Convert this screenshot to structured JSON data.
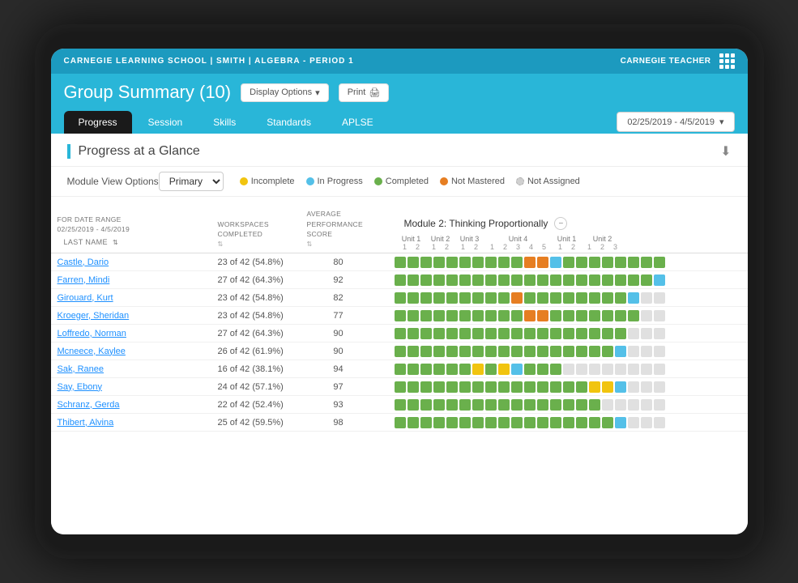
{
  "topBar": {
    "title": "CARNEGIE LEARNING SCHOOL | SMITH | ALGEBRA - PERIOD 1",
    "user": "Carnegie Teacher"
  },
  "header": {
    "title": "Group Summary (10)",
    "displayOptionsLabel": "Display Options",
    "printLabel": "Print"
  },
  "tabs": [
    {
      "id": "progress",
      "label": "Progress",
      "active": true
    },
    {
      "id": "session",
      "label": "Session",
      "active": false
    },
    {
      "id": "skills",
      "label": "Skills",
      "active": false
    },
    {
      "id": "standards",
      "label": "Standards",
      "active": false
    },
    {
      "id": "aplse",
      "label": "APLSE",
      "active": false
    }
  ],
  "dateRange": "02/25/2019 - 4/5/2019",
  "sectionTitle": "Progress at a Glance",
  "moduleViewOptions": {
    "label": "Module View Options",
    "value": "Primary"
  },
  "legend": [
    {
      "label": "Incomplete",
      "color": "#f1c40f"
    },
    {
      "label": "In Progress",
      "color": "#54c0e8"
    },
    {
      "label": "Completed",
      "color": "#6ab04c"
    },
    {
      "label": "Not Mastered",
      "color": "#e67e22"
    },
    {
      "label": "Not Assigned",
      "color": "#d0d0d0"
    }
  ],
  "tableHeaders": {
    "lastName": "LAST NAME",
    "dateRange": "FOR DATE RANGE\n02/25/2019 - 4/5/2019",
    "workspacesCompleted": "WORKSPACES COMPLETED",
    "avgPerformanceScore": "AVERAGE PERFORMANCE SCORE"
  },
  "moduleTitle": "Module 2: Thinking Proportionally",
  "units": [
    {
      "label": "Unit 1",
      "cells": [
        1,
        2
      ]
    },
    {
      "label": "Unit 2",
      "cells": [
        1,
        2
      ]
    },
    {
      "label": "Unit 3",
      "cells": [
        1,
        2
      ]
    },
    {
      "label": "Unit 4",
      "cells": [
        1,
        2,
        3,
        4,
        5
      ]
    },
    {
      "label": "Unit 1",
      "cells": [
        1,
        2
      ]
    },
    {
      "label": "Unit 2",
      "cells": [
        1,
        2,
        3
      ]
    }
  ],
  "students": [
    {
      "name": "Castle, Dario",
      "workspaces": "23 of 42 (54.8%)",
      "score": "80",
      "cells": [
        "g",
        "g",
        "g",
        "g",
        "g",
        "g",
        "g",
        "g",
        "g",
        "g",
        "o",
        "o",
        "b",
        "g",
        "g",
        "g",
        "g",
        "g",
        "g",
        "g",
        "g"
      ]
    },
    {
      "name": "Farren, Mindi",
      "workspaces": "27 of 42 (64.3%)",
      "score": "92",
      "cells": [
        "g",
        "g",
        "g",
        "g",
        "g",
        "g",
        "g",
        "g",
        "g",
        "g",
        "g",
        "g",
        "g",
        "g",
        "g",
        "g",
        "g",
        "g",
        "g",
        "g",
        "b"
      ]
    },
    {
      "name": "Girouard, Kurt",
      "workspaces": "23 of 42 (54.8%)",
      "score": "82",
      "cells": [
        "g",
        "g",
        "g",
        "g",
        "g",
        "g",
        "g",
        "g",
        "g",
        "o",
        "g",
        "g",
        "g",
        "g",
        "g",
        "g",
        "g",
        "g",
        "b",
        "e",
        "e"
      ]
    },
    {
      "name": "Kroeger, Sheridan",
      "workspaces": "23 of 42 (54.8%)",
      "score": "77",
      "cells": [
        "g",
        "g",
        "g",
        "g",
        "g",
        "g",
        "g",
        "g",
        "g",
        "g",
        "o",
        "o",
        "g",
        "g",
        "g",
        "g",
        "g",
        "g",
        "g",
        "e",
        "e"
      ]
    },
    {
      "name": "Loffredo, Norman",
      "workspaces": "27 of 42 (64.3%)",
      "score": "90",
      "cells": [
        "g",
        "g",
        "g",
        "g",
        "g",
        "g",
        "g",
        "g",
        "g",
        "g",
        "g",
        "g",
        "g",
        "g",
        "g",
        "g",
        "g",
        "g",
        "e",
        "e",
        "e"
      ]
    },
    {
      "name": "Mcneece, Kaylee",
      "workspaces": "26 of 42 (61.9%)",
      "score": "90",
      "cells": [
        "g",
        "g",
        "g",
        "g",
        "g",
        "g",
        "g",
        "g",
        "g",
        "g",
        "g",
        "g",
        "g",
        "g",
        "g",
        "g",
        "g",
        "b",
        "e",
        "e",
        "e"
      ]
    },
    {
      "name": "Sak, Ranee",
      "workspaces": "16 of 42 (38.1%)",
      "score": "94",
      "cells": [
        "g",
        "g",
        "g",
        "g",
        "g",
        "g",
        "y",
        "g",
        "y",
        "b",
        "g",
        "g",
        "g",
        "e",
        "e",
        "e",
        "e",
        "e",
        "e",
        "e",
        "e"
      ]
    },
    {
      "name": "Say, Ebony",
      "workspaces": "24 of 42 (57.1%)",
      "score": "97",
      "cells": [
        "g",
        "g",
        "g",
        "g",
        "g",
        "g",
        "g",
        "g",
        "g",
        "g",
        "g",
        "g",
        "g",
        "g",
        "g",
        "y",
        "y",
        "b",
        "e",
        "e",
        "e"
      ]
    },
    {
      "name": "Schranz, Gerda",
      "workspaces": "22 of 42 (52.4%)",
      "score": "93",
      "cells": [
        "g",
        "g",
        "g",
        "g",
        "g",
        "g",
        "g",
        "g",
        "g",
        "g",
        "g",
        "g",
        "g",
        "g",
        "g",
        "g",
        "e",
        "e",
        "e",
        "e",
        "e"
      ]
    },
    {
      "name": "Thibert, Alvina",
      "workspaces": "25 of 42 (59.5%)",
      "score": "98",
      "cells": [
        "g",
        "g",
        "g",
        "g",
        "g",
        "g",
        "g",
        "g",
        "g",
        "g",
        "g",
        "g",
        "g",
        "g",
        "g",
        "g",
        "g",
        "b",
        "e",
        "e",
        "e"
      ]
    }
  ]
}
